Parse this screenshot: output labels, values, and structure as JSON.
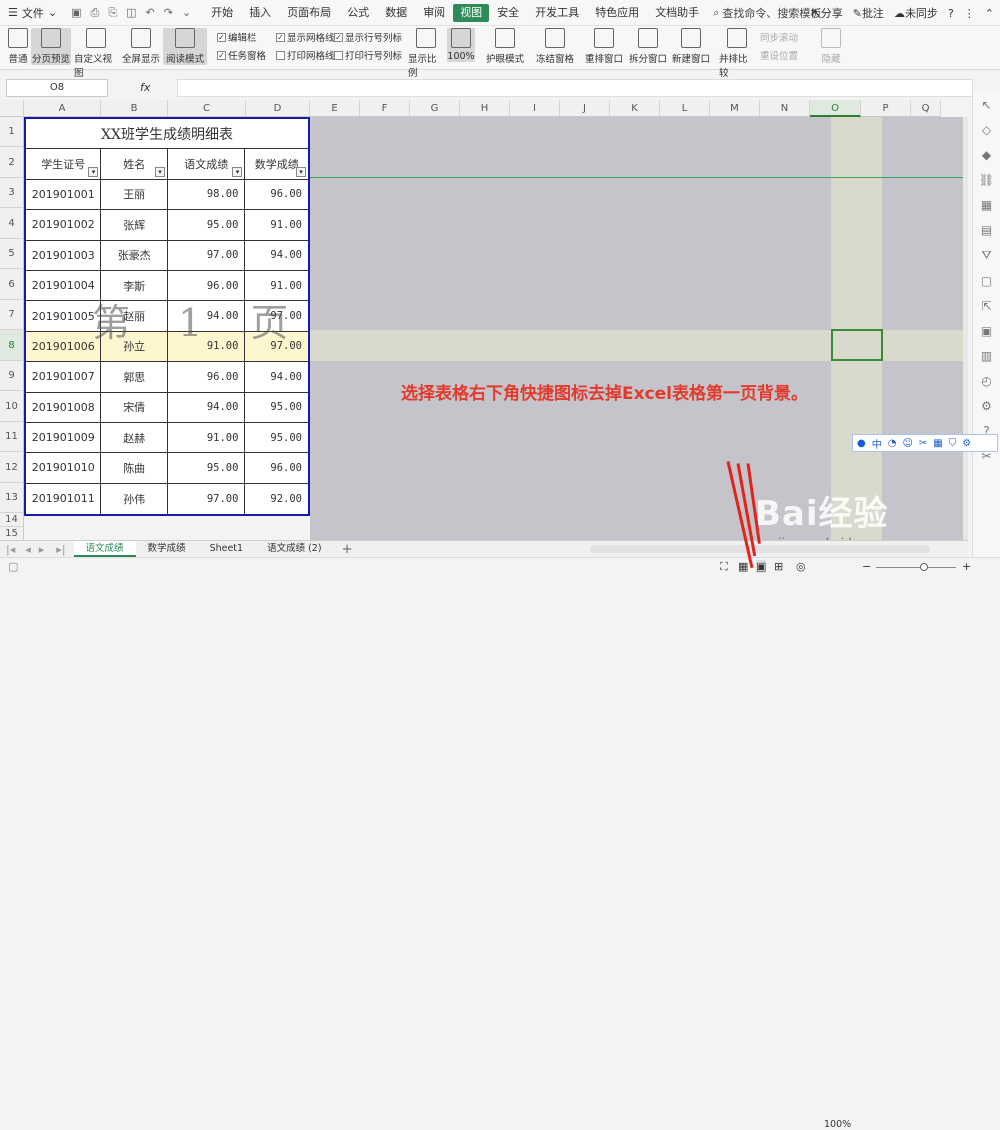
{
  "menu": {
    "file": "文件",
    "tabs": [
      "开始",
      "插入",
      "页面布局",
      "公式",
      "数据",
      "审阅",
      "视图",
      "安全",
      "开发工具",
      "特色应用",
      "文档助手"
    ],
    "active_tab": "视图",
    "search": "查找命令、搜索模板",
    "share": "分享",
    "comment": "批注",
    "sync": "未同步"
  },
  "ribbon": {
    "normal": "普通",
    "page_break": "分页预览",
    "custom_view": "自定义视图",
    "fullscreen": "全屏显示",
    "reading": "阅读模式",
    "edit_bar": "编辑栏",
    "task_pane": "任务窗格",
    "show_grid": "显示网格线",
    "print_grid": "打印网格线",
    "show_rowcol": "显示行号列标",
    "print_rowcol": "打印行号列标",
    "zoom_display": "显示比例",
    "zoom_100": "100%",
    "eye_mode": "护眼模式",
    "freeze": "冻结窗格",
    "rearrange": "重排窗口",
    "split": "拆分窗口",
    "new_window": "新建窗口",
    "side_by_side": "并排比较",
    "sync_scroll": "同步滚动",
    "reset_pos": "重设位置",
    "hide": "隐藏"
  },
  "formula_bar": {
    "cell_ref": "O8",
    "fx": "fx"
  },
  "columns": [
    "A",
    "B",
    "C",
    "D",
    "E",
    "F",
    "G",
    "H",
    "I",
    "J",
    "K",
    "L",
    "M",
    "N",
    "O",
    "P",
    "Q"
  ],
  "rows": [
    "1",
    "2",
    "3",
    "4",
    "5",
    "6",
    "7",
    "8",
    "9",
    "10",
    "11",
    "12",
    "13",
    "14",
    "15"
  ],
  "selected_col": "O",
  "selected_row": "8",
  "table": {
    "title": "XX班学生成绩明细表",
    "headers": [
      "学生证号",
      "姓名",
      "语文成绩",
      "数学成绩"
    ],
    "data": [
      [
        "201901001",
        "王丽",
        "98.00",
        "96.00"
      ],
      [
        "201901002",
        "张辉",
        "95.00",
        "91.00"
      ],
      [
        "201901003",
        "张豪杰",
        "97.00",
        "94.00"
      ],
      [
        "201901004",
        "李斯",
        "96.00",
        "91.00"
      ],
      [
        "201901005",
        "赵丽",
        "94.00",
        "97.00"
      ],
      [
        "201901006",
        "孙立",
        "91.00",
        "97.00"
      ],
      [
        "201901007",
        "郭思",
        "96.00",
        "94.00"
      ],
      [
        "201901008",
        "宋倩",
        "94.00",
        "95.00"
      ],
      [
        "201901009",
        "赵赫",
        "91.00",
        "95.00"
      ],
      [
        "201901010",
        "陈曲",
        "95.00",
        "96.00"
      ],
      [
        "201901011",
        "孙伟",
        "97.00",
        "92.00"
      ]
    ]
  },
  "watermark": "第 1 页",
  "annotation": "选择表格右下角快捷图标去掉Excel表格第一页背景。",
  "sheet_tabs": [
    "语文成绩",
    "数学成绩",
    "Sheet1",
    "语文成绩 (2)"
  ],
  "active_sheet": "语文成绩",
  "status": {
    "zoom": "100%"
  },
  "ime_label": "中",
  "brand": {
    "logo": "Bai经验",
    "url": "jingyan.baidu.com"
  }
}
